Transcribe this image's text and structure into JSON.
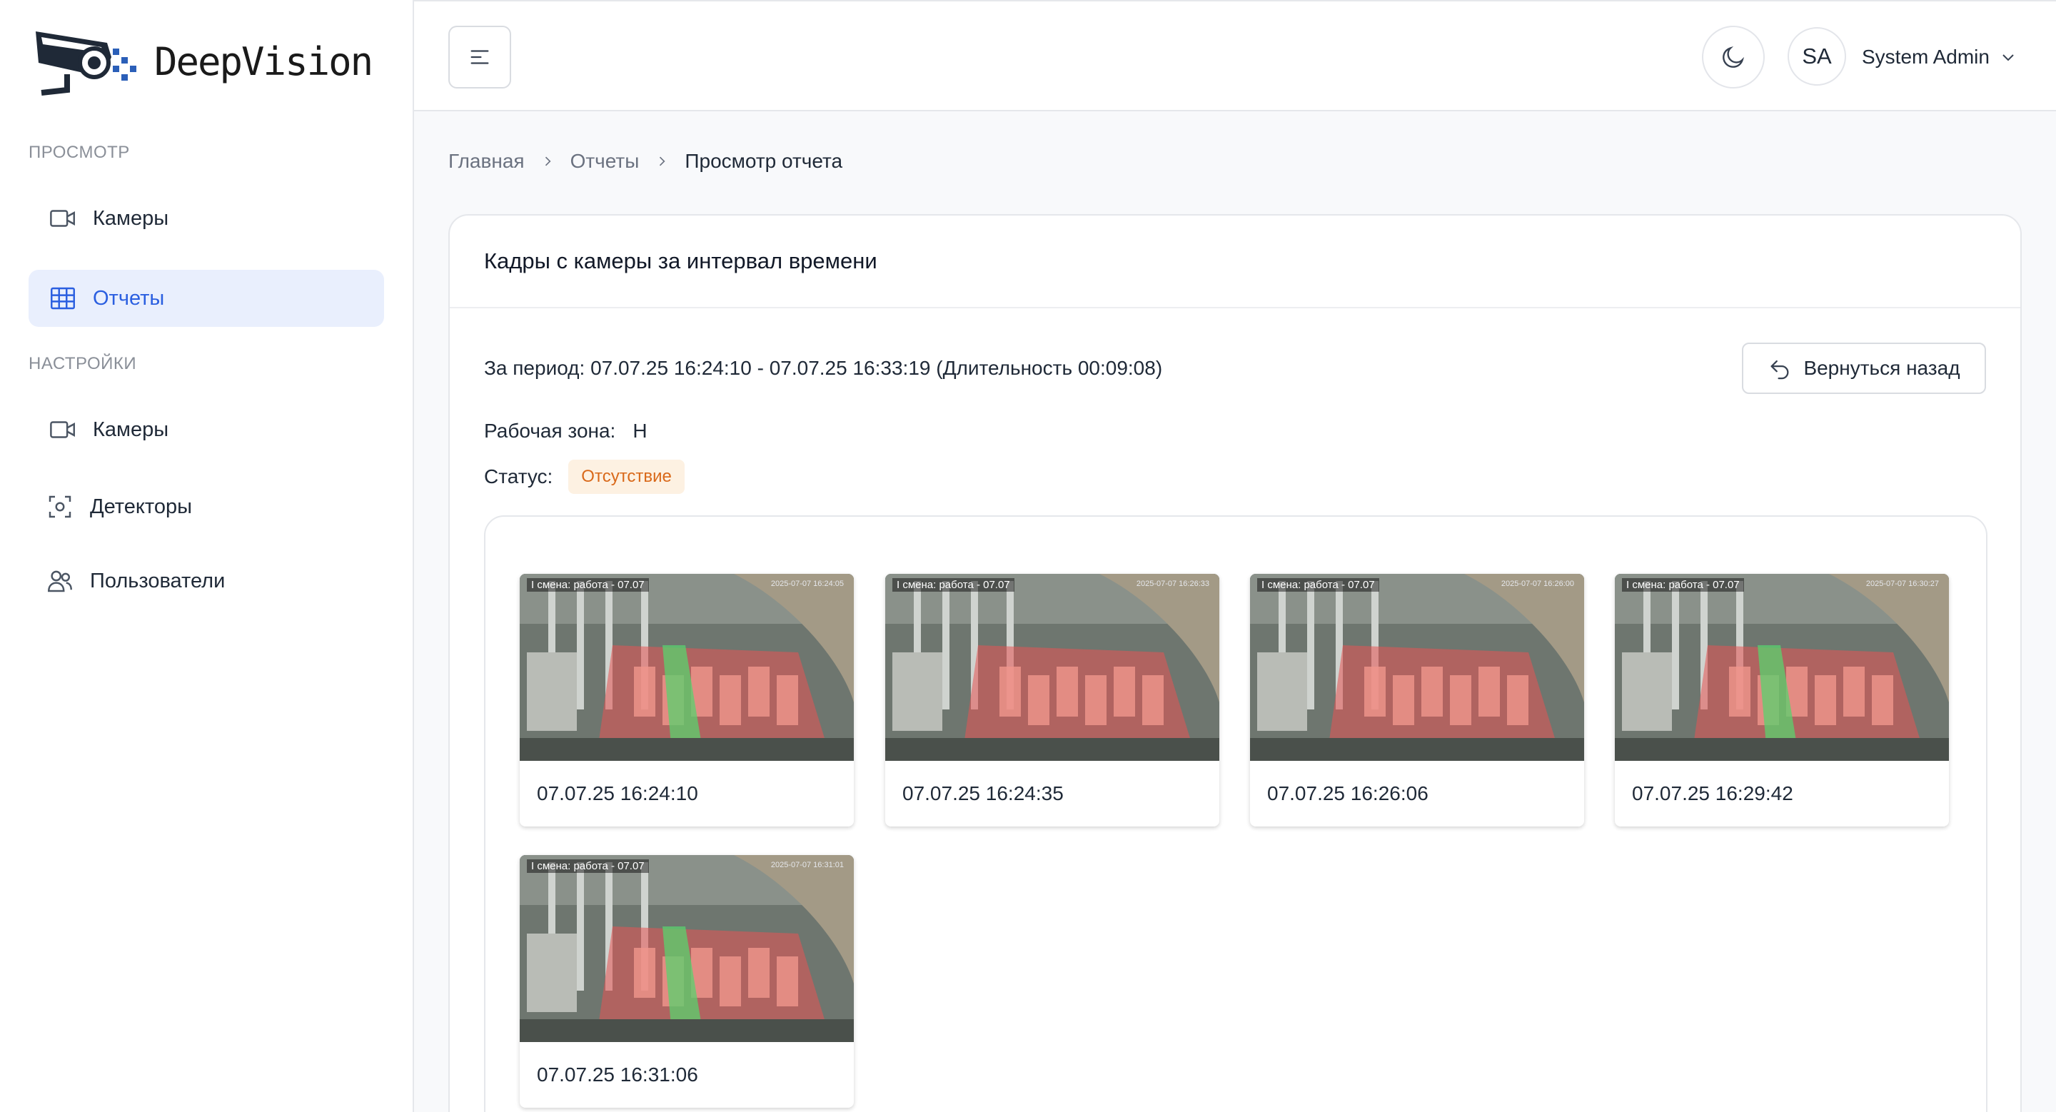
{
  "app": {
    "name": "DeepVision"
  },
  "sidebar": {
    "sections": [
      {
        "title": "ПРОСМОТР"
      },
      {
        "title": "НАСТРОЙКИ"
      }
    ],
    "items": [
      {
        "label": "Камеры",
        "icon": "video-camera-icon"
      },
      {
        "label": "Отчеты",
        "icon": "table-icon",
        "active": true
      },
      {
        "label": "Камеры",
        "icon": "video-camera-icon"
      },
      {
        "label": "Детекторы",
        "icon": "focus-icon"
      },
      {
        "label": "Пользователи",
        "icon": "users-icon"
      }
    ]
  },
  "header": {
    "avatar_initials": "SA",
    "user_name": "System Admin"
  },
  "breadcrumb": {
    "items": [
      "Главная",
      "Отчеты",
      "Просмотр отчета"
    ]
  },
  "report": {
    "title": "Кадры с камеры за интервал времени",
    "period": "За период: 07.07.25 16:24:10 - 07.07.25 16:33:19 (Длительность 00:09:08)",
    "back_label": "Вернуться назад",
    "zone_label": "Рабочая зона:",
    "zone_value": "Н",
    "status_label": "Статус:",
    "status_value": "Отсутствие",
    "status_color": "#d9691a"
  },
  "frames": [
    {
      "overlay_title": "I смена: работа - 07.07",
      "overlay_ts": "2025-07-07 16:24:05",
      "timestamp": "07.07.25 16:24:10",
      "green_lane": true
    },
    {
      "overlay_title": "I смена: работа - 07.07",
      "overlay_ts": "2025-07-07 16:26:33",
      "timestamp": "07.07.25 16:24:35",
      "green_lane": false
    },
    {
      "overlay_title": "I смена: работа - 07.07",
      "overlay_ts": "2025-07-07 16:26:00",
      "timestamp": "07.07.25 16:26:06",
      "green_lane": false
    },
    {
      "overlay_title": "I смена: работа - 07.07",
      "overlay_ts": "2025-07-07 16:30:27",
      "timestamp": "07.07.25 16:29:42",
      "green_lane": true
    },
    {
      "overlay_title": "I смена: работа - 07.07",
      "overlay_ts": "2025-07-07 16:31:01",
      "timestamp": "07.07.25 16:31:06",
      "green_lane": true
    }
  ]
}
